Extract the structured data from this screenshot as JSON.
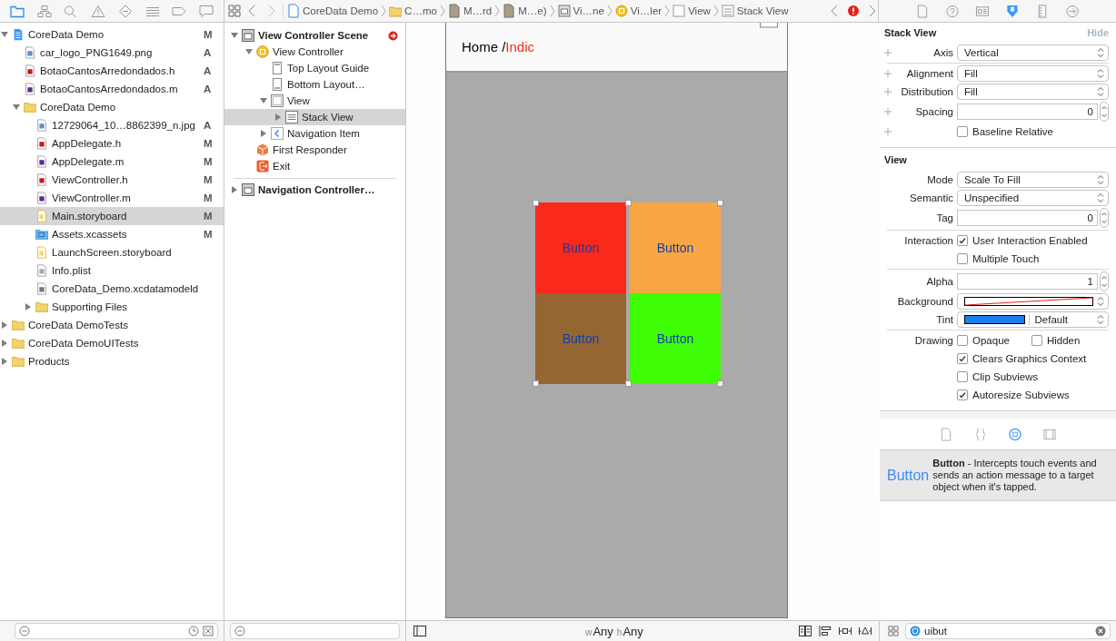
{
  "navigator": {
    "files": [
      {
        "name": "CoreData Demo",
        "kind": "project",
        "status": "M",
        "expanded": true,
        "selected": false,
        "children": [
          {
            "name": "car_logo_PNG1649.png",
            "kind": "image",
            "status": "A",
            "selected": false
          },
          {
            "name": "BotaoCantosArredondados.h",
            "kind": "h",
            "status": "A",
            "selected": false
          },
          {
            "name": "BotaoCantosArredondados.m",
            "kind": "m",
            "status": "A",
            "selected": false
          },
          {
            "name": "CoreData Demo",
            "kind": "folder",
            "expanded": true,
            "selected": false,
            "children": [
              {
                "name": "12729064_10…8862399_n.jpg",
                "kind": "image",
                "status": "A",
                "selected": false
              },
              {
                "name": "AppDelegate.h",
                "kind": "h",
                "status": "M",
                "selected": false
              },
              {
                "name": "AppDelegate.m",
                "kind": "m",
                "status": "M",
                "selected": false
              },
              {
                "name": "ViewController.h",
                "kind": "h",
                "status": "M",
                "selected": false
              },
              {
                "name": "ViewController.m",
                "kind": "m",
                "status": "M",
                "selected": false
              },
              {
                "name": "Main.storyboard",
                "kind": "storyboard",
                "status": "M",
                "selected": true
              },
              {
                "name": "Assets.xcassets",
                "kind": "assets",
                "status": "M",
                "selected": false
              },
              {
                "name": "LaunchScreen.storyboard",
                "kind": "storyboard",
                "selected": false
              },
              {
                "name": "Info.plist",
                "kind": "plist",
                "selected": false
              },
              {
                "name": "CoreData_Demo.xcdatamodeld",
                "kind": "model",
                "selected": false
              },
              {
                "name": "Supporting Files",
                "kind": "folder",
                "expanded": false,
                "selected": false
              }
            ]
          }
        ]
      },
      {
        "name": "CoreData DemoTests",
        "kind": "folder",
        "expanded": false,
        "selected": false
      },
      {
        "name": "CoreData DemoUITests",
        "kind": "folder",
        "expanded": false,
        "selected": false
      },
      {
        "name": "Products",
        "kind": "folder",
        "expanded": false,
        "selected": false
      }
    ]
  },
  "jump_bar": {
    "crumbs": [
      {
        "label": "CoreData Demo",
        "kind": "project"
      },
      {
        "label": "C…mo",
        "kind": "folder"
      },
      {
        "label": "M…rd",
        "kind": "storyboard"
      },
      {
        "label": "M…e)",
        "kind": "storyboard"
      },
      {
        "label": "Vi…ne",
        "kind": "scene"
      },
      {
        "label": "Vi…ler",
        "kind": "controller"
      },
      {
        "label": "View",
        "kind": "view"
      },
      {
        "label": "Stack View",
        "kind": "stack"
      }
    ]
  },
  "outline": {
    "scenes": [
      {
        "label": "View Controller Scene",
        "kind": "scene",
        "bold": true,
        "issue": true,
        "expanded": true,
        "selected": false,
        "children": [
          {
            "label": "View Controller",
            "kind": "controller",
            "expanded": true,
            "selected": false,
            "children": [
              {
                "label": "Top Layout Guide",
                "kind": "guide",
                "selected": false
              },
              {
                "label": "Bottom Layout…",
                "kind": "guide-bottom",
                "selected": false
              },
              {
                "label": "View",
                "kind": "view",
                "expanded": true,
                "selected": false,
                "children": [
                  {
                    "label": "Stack View",
                    "kind": "stack",
                    "expanded": false,
                    "selected": true
                  }
                ]
              },
              {
                "label": "Navigation Item",
                "kind": "navitem",
                "expanded": false,
                "selected": false
              }
            ]
          },
          {
            "label": "First Responder",
            "kind": "responder",
            "selected": false
          },
          {
            "label": "Exit",
            "kind": "exit",
            "selected": false
          }
        ]
      },
      {
        "label": "Navigation Controller…",
        "kind": "scene",
        "bold": true,
        "expanded": false,
        "selected": false
      }
    ]
  },
  "canvas": {
    "nav_title": "Home /",
    "nav_title_accent": "Indic",
    "buttons": [
      {
        "label": "Button",
        "color": "#fb291c"
      },
      {
        "label": "Button",
        "color": "#f9a645"
      },
      {
        "label": "Button",
        "color": "#966632"
      },
      {
        "label": "Button",
        "color": "#40fe03"
      }
    ],
    "size_class": {
      "w_prefix": "w",
      "w": "Any",
      "h_prefix": "h",
      "h": "Any"
    }
  },
  "inspector": {
    "sections": [
      {
        "title": "Stack View",
        "action": "Hide",
        "plus_buttons": true,
        "rows": [
          {
            "kind": "popup",
            "label": "Axis",
            "value": "Vertical"
          },
          {
            "kind": "separator"
          },
          {
            "kind": "popup",
            "label": "Alignment",
            "value": "Fill"
          },
          {
            "kind": "popup",
            "label": "Distribution",
            "value": "Fill"
          },
          {
            "kind": "stepper",
            "label": "Spacing",
            "value": "0"
          },
          {
            "kind": "checks",
            "checks": [
              {
                "text": "Baseline Relative",
                "checked": false
              }
            ]
          }
        ]
      },
      {
        "title": "View",
        "plus_buttons": false,
        "rows": [
          {
            "kind": "popup",
            "label": "Mode",
            "value": "Scale To Fill"
          },
          {
            "kind": "popup",
            "label": "Semantic",
            "value": "Unspecified"
          },
          {
            "kind": "stepper",
            "label": "Tag",
            "value": "0"
          },
          {
            "kind": "separator"
          },
          {
            "kind": "checks",
            "label": "Interaction",
            "checks": [
              {
                "text": "User Interaction Enabled",
                "checked": true
              }
            ]
          },
          {
            "kind": "checks",
            "checks": [
              {
                "text": "Multiple Touch",
                "checked": false
              }
            ]
          },
          {
            "kind": "separator"
          },
          {
            "kind": "stepper",
            "label": "Alpha",
            "value": "1"
          },
          {
            "kind": "color",
            "label": "Background"
          },
          {
            "kind": "tint",
            "label": "Tint",
            "value": "Default",
            "color": "#1e7cf0"
          },
          {
            "kind": "separator"
          },
          {
            "kind": "checks",
            "label": "Drawing",
            "checks": [
              {
                "text": "Opaque",
                "checked": false
              },
              {
                "text": "Hidden",
                "checked": false
              }
            ]
          },
          {
            "kind": "checks",
            "checks": [
              {
                "text": "Clears Graphics Context",
                "checked": true
              }
            ]
          },
          {
            "kind": "checks",
            "checks": [
              {
                "text": "Clip Subviews",
                "checked": false
              }
            ]
          },
          {
            "kind": "checks",
            "checks": [
              {
                "text": "Autoresize Subviews",
                "checked": true
              }
            ]
          }
        ]
      }
    ]
  },
  "library": {
    "preview": "Button",
    "description": "**Button** - Intercepts touch events and sends an action message to a target object when it's tapped.",
    "search": {
      "value": "uibut"
    }
  }
}
